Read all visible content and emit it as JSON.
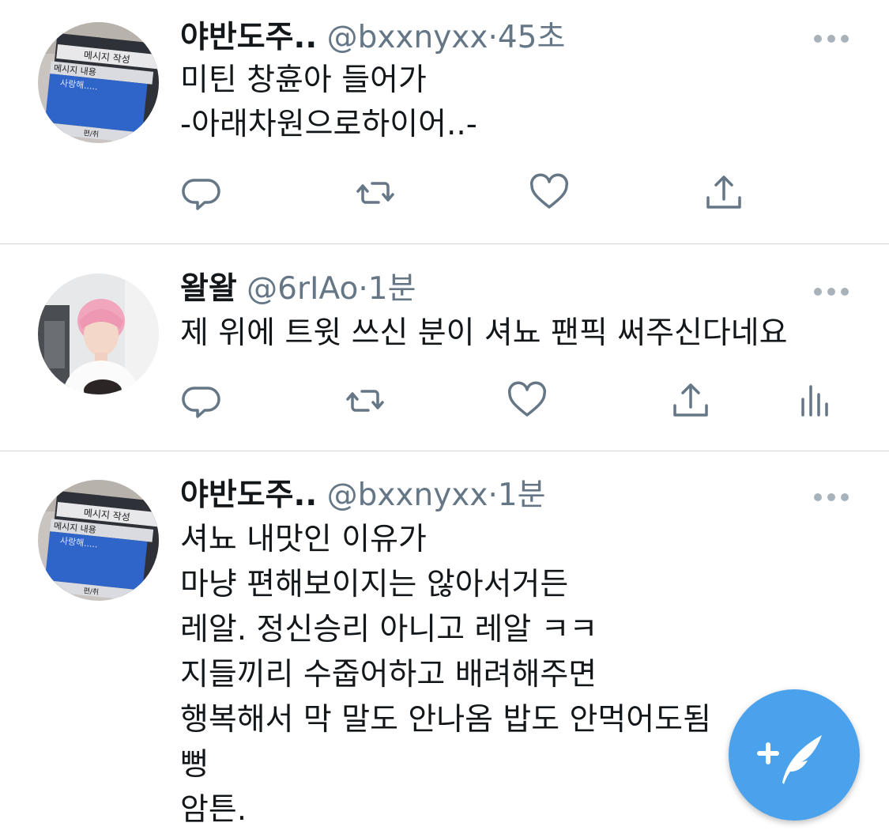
{
  "tweets": [
    {
      "name": "야반도주..",
      "handle": "@bxxnyxx",
      "dot": "·",
      "time": "45초",
      "lines": [
        "미틴 창휸아 들어가",
        "-아래차원으로하이어..-"
      ],
      "avatar": {
        "screen_title": "메시지 작성",
        "label": "메시지 내용",
        "text": "사랑해.....",
        "footer": "편/취",
        "type": "phone-message-screen"
      }
    },
    {
      "name": "왈왈",
      "handle": "@6rIAo",
      "dot": "·",
      "time": "1분",
      "lines": [
        "제 위에 트윗 쓰신 분이 셔뇨 팬픽 써주신다네요"
      ],
      "avatar": {
        "type": "pink-hair-person-photo"
      }
    },
    {
      "name": "야반도주..",
      "handle": "@bxxnyxx",
      "dot": "·",
      "time": "1분",
      "lines": [
        "셔뇨 내맛인 이유가",
        "마냥 편해보이지는 않아서거든",
        "레알. 정신승리 아니고 레알 ㅋㅋ",
        "지들끼리 수줍어하고 배려해주면",
        "행복해서 막 말도 안나옴 밥도 안먹어도됨",
        "뻥",
        "암튼."
      ],
      "avatar": {
        "screen_title": "메시지 작성",
        "label": "메시지 내용",
        "text": "사랑해.....",
        "footer": "편/취",
        "type": "phone-message-screen"
      }
    }
  ],
  "icons": {
    "reply": "reply-icon",
    "retweet": "retweet-icon",
    "like": "like-icon",
    "share": "share-icon",
    "analytics": "analytics-icon",
    "more": "more-icon",
    "compose": "compose-tweet-icon"
  },
  "colors": {
    "icon_gray": "#657786",
    "fab_blue": "#4aa1ec",
    "divider": "#d3d6db"
  }
}
